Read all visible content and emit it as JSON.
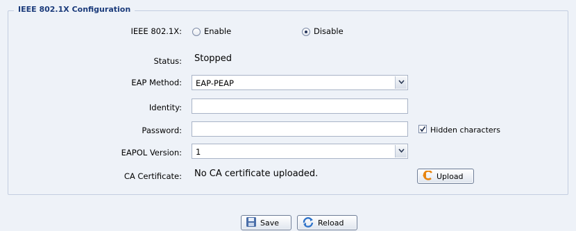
{
  "section": {
    "title": "IEEE 802.1X Configuration"
  },
  "ieee8021x": {
    "label": "IEEE 802.1X:",
    "options": [
      {
        "label": "Enable",
        "selected": false
      },
      {
        "label": "Disable",
        "selected": true
      }
    ]
  },
  "status": {
    "label": "Status:",
    "value": "Stopped"
  },
  "eap_method": {
    "label": "EAP Method:",
    "value": "EAP-PEAP"
  },
  "identity": {
    "label": "Identity:",
    "value": ""
  },
  "password": {
    "label": "Password:",
    "value": ""
  },
  "hidden_chars": {
    "label": "Hidden characters",
    "checked": true
  },
  "eapol_version": {
    "label": "EAPOL Version:",
    "value": "1"
  },
  "ca_certificate": {
    "label": "CA Certificate:",
    "value": "No CA certificate uploaded.",
    "upload_label": "Upload"
  },
  "footer": {
    "save_label": "Save",
    "reload_label": "Reload"
  }
}
